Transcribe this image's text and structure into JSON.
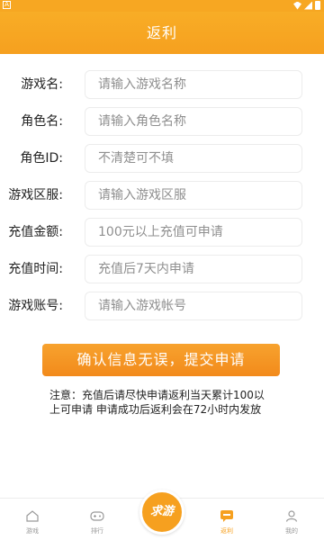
{
  "colors": {
    "accent": "#f6a01f",
    "button": "#f28a1b",
    "background": "#f5f5f5"
  },
  "status_bar": {
    "left_glyph": "A",
    "icons": [
      "wifi-icon",
      "signal-icon",
      "battery-icon"
    ]
  },
  "header": {
    "title": "返利"
  },
  "form": {
    "rows": [
      {
        "label": "游戏名:",
        "placeholder": "请输入游戏名称"
      },
      {
        "label": "角色名:",
        "placeholder": "请输入角色名称"
      },
      {
        "label": "角色ID:",
        "placeholder": "不清楚可不填"
      },
      {
        "label": "游戏区服:",
        "placeholder": "请输入游戏区服"
      },
      {
        "label": "充值金额:",
        "placeholder": "100元以上充值可申请"
      },
      {
        "label": "充值时间:",
        "placeholder": "充值后7天内申请"
      },
      {
        "label": "游戏账号:",
        "placeholder": "请输入游戏帐号"
      }
    ],
    "submit_label": "确认信息无误，提交申请",
    "notice": "注意：充值后请尽快申请返利当天累计100以上可申请 申请成功后返利会在72小时内发放"
  },
  "tabbar": {
    "tabs": [
      {
        "label": "游戏",
        "icon": "home-icon"
      },
      {
        "label": "排行",
        "icon": "gamepad-icon"
      },
      {
        "label": "返利",
        "icon": "rebate-icon",
        "active": true
      },
      {
        "label": "我的",
        "icon": "user-icon"
      }
    ],
    "center_label": "求游"
  }
}
